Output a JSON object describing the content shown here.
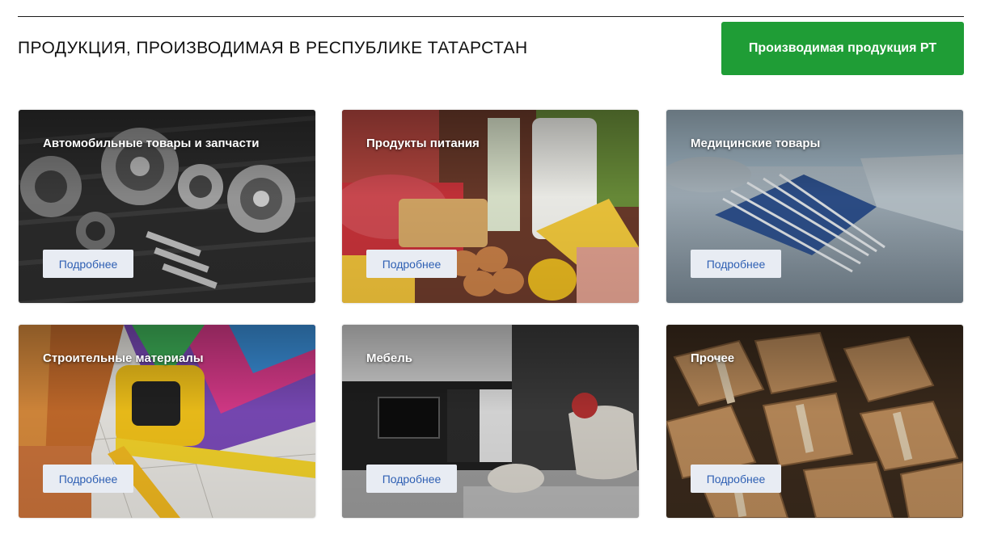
{
  "header": {
    "title": "ПРОДУКЦИЯ, ПРОИЗВОДИМАЯ В РЕСПУБЛИКЕ ТАТАРСТАН",
    "cta_label": "Производимая продукция РТ",
    "cta_color": "#1f9d36"
  },
  "categories": [
    {
      "title": "Автомобильные товары и запчасти",
      "button": "Подробнее",
      "image": "auto-parts-photo"
    },
    {
      "title": "Продукты питания",
      "button": "Подробнее",
      "image": "food-products-photo"
    },
    {
      "title": "Медицинские товары",
      "button": "Подробнее",
      "image": "medical-instruments-photo"
    },
    {
      "title": "Строительные материалы",
      "button": "Подробнее",
      "image": "building-materials-photo"
    },
    {
      "title": "Мебель",
      "button": "Подробнее",
      "image": "furniture-interior-photo"
    },
    {
      "title": "Прочее",
      "button": "Подробнее",
      "image": "cardboard-boxes-photo"
    }
  ]
}
